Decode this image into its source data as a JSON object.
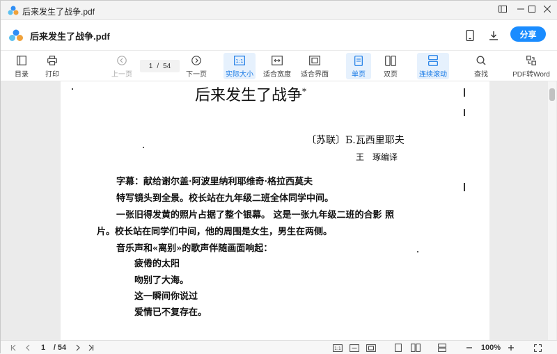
{
  "window": {
    "title": "后来发生了战争.pdf"
  },
  "header": {
    "doc_title": "后来发生了战争.pdf",
    "share_label": "分享"
  },
  "toolbar": {
    "items": [
      {
        "label": "目录",
        "icon": "outline-icon"
      },
      {
        "label": "打印",
        "icon": "printer-icon"
      },
      {
        "label": "上一页",
        "icon": "prev-page-icon"
      },
      {
        "label": "下一页",
        "icon": "next-page-icon"
      },
      {
        "label": "实际大小",
        "icon": "actual-size-icon"
      },
      {
        "label": "适合宽度",
        "icon": "fit-width-icon"
      },
      {
        "label": "适合界面",
        "icon": "fit-page-icon"
      },
      {
        "label": "单页",
        "icon": "single-page-icon"
      },
      {
        "label": "双页",
        "icon": "double-page-icon"
      },
      {
        "label": "连续滚动",
        "icon": "continuous-scroll-icon"
      },
      {
        "label": "查找",
        "icon": "search-icon"
      },
      {
        "label": "PDF转Word",
        "icon": "pdf-to-word-icon"
      }
    ],
    "current_page": "1",
    "total_pages": "54"
  },
  "document": {
    "title": "后来发生了战争",
    "title_mark": "*",
    "author": "〔苏联〕Б.瓦西里耶夫",
    "translator": "王　琢编译",
    "lines": [
      "字幕：献给谢尔盖·阿波里纳利耶维奇·格拉西莫夫",
      "特写镜头到全景。校长站在九年级二班全体同学中间。",
      "一张旧得发黄的照片占据了整个银幕。 这是一张九年级二班的合影 照",
      "片。校长站在同学们中间，他的周围是女生，男生在两侧。",
      "音乐声和«离别»的歌声伴随画面响起："
    ],
    "verse": [
      "疲倦的太阳",
      "吻别了大海。",
      "这一瞬间你说过",
      "爱情已不复存在。"
    ]
  },
  "statusbar": {
    "current_page": "1",
    "total_pages": "/ 54",
    "zoom": "100%"
  },
  "colors": {
    "accent": "#1a8cff",
    "active_bg": "#e6f1fd"
  }
}
